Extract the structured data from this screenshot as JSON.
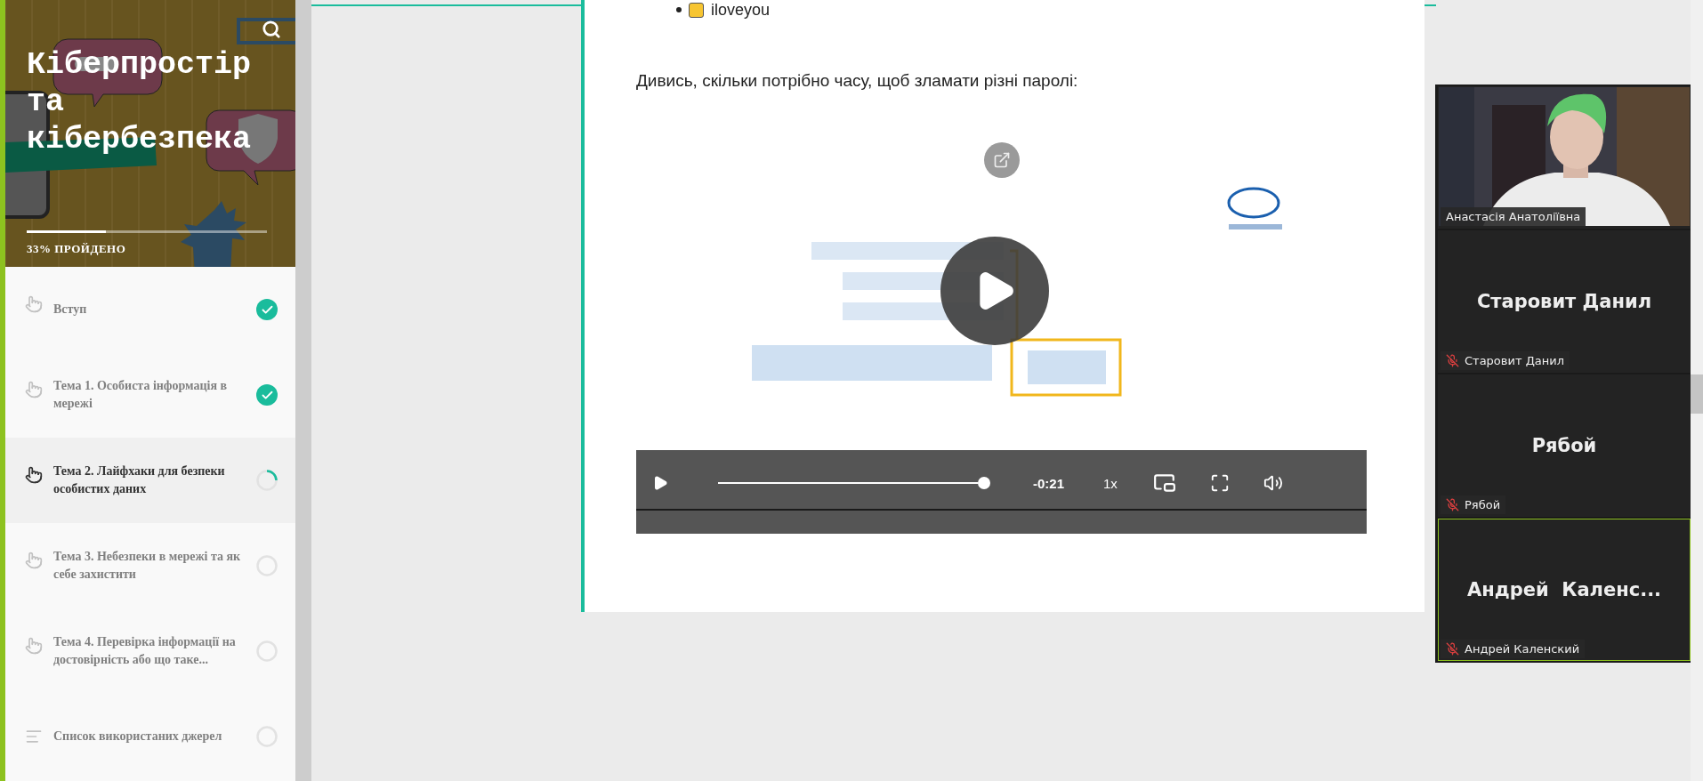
{
  "sidebar": {
    "course_title": "Кіберпростір та кібербезпека",
    "progress": {
      "level": 0.33,
      "label": "33% ПРОЙДЕНО"
    },
    "lessons": [
      {
        "title": "Вступ",
        "kind": "lesson",
        "completed": true,
        "in_progress": false,
        "selected": false
      },
      {
        "title": "Тема 1. Особиста інформація в мережі",
        "kind": "lesson",
        "completed": true,
        "in_progress": false,
        "selected": false
      },
      {
        "title": "Тема 2. Лайфхаки для безпеки особистих даних",
        "kind": "lesson",
        "completed": false,
        "in_progress": true,
        "selected": true
      },
      {
        "title": "Тема 3. Небезпеки в мережі та як себе захистити",
        "kind": "lesson",
        "completed": false,
        "in_progress": false,
        "selected": false
      },
      {
        "title": "Тема 4. Перевірка інформації на достовірність або що таке...",
        "kind": "lesson",
        "completed": false,
        "in_progress": false,
        "selected": false
      },
      {
        "title": "Список використаних джерел",
        "kind": "list",
        "completed": false,
        "in_progress": false,
        "selected": false
      }
    ]
  },
  "content": {
    "bullets": [
      "iloveyou"
    ],
    "paragraph": "Дивись, скільки потрібно часу, щоб зламати різні паролі:",
    "video": {
      "seek": {
        "level": 1
      },
      "time_remaining": "-0:21",
      "speed": "1x"
    }
  },
  "meeting": {
    "participants": [
      {
        "name": "Анастасія Анатоліївна",
        "kind": "camera",
        "muted": false,
        "active": false
      },
      {
        "name": "Старовит Данил",
        "display_name": "Старовит Данил",
        "kind": "avatar",
        "muted": true,
        "active": false
      },
      {
        "name": "Рябой",
        "display_name": "Рябой",
        "kind": "avatar",
        "muted": true,
        "active": false
      },
      {
        "name": "Андрей Каленский",
        "display_name": "Андрей  Каленс...",
        "kind": "avatar",
        "muted": true,
        "active": true
      }
    ]
  }
}
